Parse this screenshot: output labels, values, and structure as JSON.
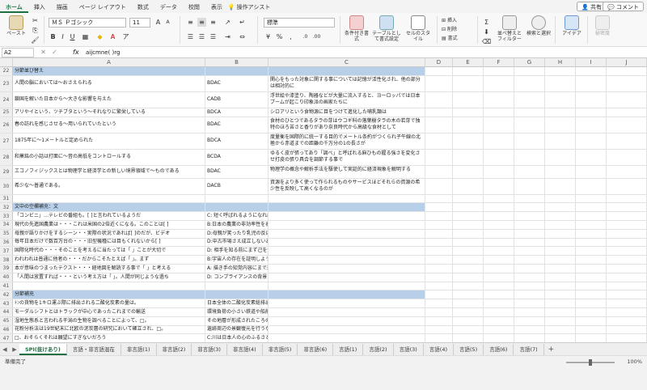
{
  "tabs": [
    "ホーム",
    "挿入",
    "描画",
    "ページ レイアウト",
    "数式",
    "データ",
    "校閲",
    "表示"
  ],
  "tab_search": "操作アシスト",
  "share_label": "共有",
  "comment_label": "コメント",
  "ribbon": {
    "paste_label": "ペースト",
    "font_name": "ＭＳ Ｐゴシック",
    "font_size": "11",
    "number_format": "標準",
    "conditional_format": "条件付き書式",
    "format_as_table": "テーブルとして書式設定",
    "cell_styles": "セルのスタイル",
    "insert": "挿入",
    "delete": "削除",
    "format": "書式",
    "sort_filter": "並べ替えとフィルター",
    "find_select": "検索と選択",
    "ideas": "アイデア",
    "sensitivity": "秘密度"
  },
  "formula_bar": {
    "cell_ref": "A2",
    "fx": "fx",
    "value": "aijcmne( )rg"
  },
  "columns": [
    "A",
    "B",
    "C",
    "D",
    "E",
    "F",
    "G",
    "H",
    "I",
    "J"
  ],
  "rows": [
    {
      "n": "22",
      "a": "分節並び替え",
      "b": "",
      "c": "",
      "section": true
    },
    {
      "n": "23",
      "a": "人間の脳においては～おさえられる",
      "b": "BDAC",
      "c": "関心をもった対象に関する事については記憶が活性化され、他の部分は相対的に"
    },
    {
      "n": "24",
      "a": "鎖国を解いた日本から～大きな影響を与えた",
      "b": "CADB",
      "c": "浮世絵や漆塗り、陶器などが大量に流入すると、ヨーロッパでは日本ブームが起こり印象派の画家たちに"
    },
    {
      "n": "25",
      "a": "アリやイという、ツチブタという～それなりに繁栄している",
      "b": "BDCA",
      "c": "シロアリという食物源に目をつけて進化した哺乳類は"
    },
    {
      "n": "26",
      "a": "春の訪れを感じさせる～用いられていたという",
      "b": "BDAC",
      "c": "食材のひとつであるタラの芽はウコギ科の落葉樹タラの木の若芽で独特のほろ苦さと香りがあり奈良時代から高級な食材として"
    },
    {
      "n": "27",
      "a": "1875年に～1メートルと定められた",
      "b": "BDCA",
      "c": "度量衡を国際的に統一する目的でメートル条約がつくられ子午線の北極から赤道までの距離の千万分の1の長さが"
    },
    {
      "n": "28",
      "a": "和菓銘の小話は打面に～音の高低をコントロールする",
      "b": "BCDA",
      "c": "ゆるく皮が張ってあり「調べ」と呼ばれる麻ひもの握る強さを変化させ打皮の張り具合を調節する事で"
    },
    {
      "n": "29",
      "a": "エコノフィジックスとは物理学と経済学との新しい境界領域で～ものである",
      "b": "BDAC",
      "c": "物理学の概念や解析手法を駆使して実証的に経済現象を解明する"
    },
    {
      "n": "30",
      "a": "希少な～普通である。",
      "b": "DACB",
      "c": "資源をより多く使って作られるものやサービスほどそれらの資源の希少性を反映して高くなるのが"
    },
    {
      "n": "31",
      "a": "",
      "b": "",
      "c": ""
    },
    {
      "n": "32",
      "a": "文中の空欄補充：文",
      "b": "",
      "c": "",
      "section": true
    },
    {
      "n": "33",
      "a": "「コンビニ」…テレビの番組も。[ ]と言われているようだ",
      "b": "C: 短く呼ばれるようになればヒット間然だ",
      "c": ""
    },
    {
      "n": "34",
      "a": "現代の先進国農業は・・・これは米国の2倍近くになる。このことは[ ]",
      "b": "B:日本の農業の非効率性を表している",
      "c": ""
    },
    {
      "n": "35",
      "a": "母親が語りかけをするシーン・・実際の状況であれば[ ]のだが、ビデオ",
      "b": "D:母親が笑ったり乳児の反応に答えたりと",
      "c": ""
    },
    {
      "n": "36",
      "a": "毎年日本だけで数百万台の・・・旧型機種には目もくれないから[ ]",
      "b": "D:中古市場さえ成立しないありさまだ",
      "c": ""
    },
    {
      "n": "37",
      "a": "国際化時代の・・・そのことを考えるに当たっては「 」ことが大切で",
      "b": "D: 相手を知る前にまず己を知る",
      "c": ""
    },
    {
      "n": "38",
      "a": "われわれは普通に他者の・・・だからこそたとえば「 」。まず",
      "b": "B:宇宙人の存在を証明しようとする人々は",
      "c": ""
    },
    {
      "n": "39",
      "a": "本が意味のつまったテクスト・・・経地図を解読する事で「 」と考える",
      "b": "A: 描き手の知覚内容にまで近づくことが",
      "c": ""
    },
    {
      "n": "40",
      "a": "「人間は放置すれば・・・という考え方は「 」。人間が同じような過ち",
      "b": "D: コンプライアンスの背景にある法文化の",
      "c": ""
    },
    {
      "n": "41",
      "a": "",
      "b": "",
      "c": ""
    },
    {
      "n": "42",
      "a": "分節補充",
      "b": "",
      "c": "",
      "section": true
    },
    {
      "n": "43",
      "a": "ﾄﾝの貨物を1キロ運ぶ際に排出される二酸化炭素の量は。",
      "b": "日本全体の二酸化炭素総排出量の約2割",
      "c": ""
    },
    {
      "n": "44",
      "a": "モーダルシフトとはトラックが中心であったこれまでの輸送",
      "b": "環境負荷の小さい鉄道や船舶による輸送",
      "c": ""
    },
    {
      "n": "45",
      "a": "湿地生態系と言われる干潟の生物を調べることによって、□。",
      "b": "その地層が形成されたころの周囲の植生や",
      "c": ""
    },
    {
      "n": "46",
      "a": "花粉分析法は19世紀末に北欧の泥炭層の研究において確立され、□。",
      "b": "遺跡周辺の景観復元を行うなど環境考古学",
      "c": ""
    },
    {
      "n": "47",
      "a": "□、おそらくそれは願望にすぎないだろう",
      "b": "C:川は日本人の心のふるさとだと答える",
      "c": ""
    },
    {
      "n": "48",
      "a": "□、同時に水利を可能ならしめるものであった",
      "b": "D:森林に囲まれていた事は土壌の豊かさを示す",
      "c": ""
    },
    {
      "n": "49",
      "a": "エレクトロニクス製品の故障が起こる季節確率は",
      "b": "D:非常に低い事を優れた人は知っている",
      "c": ""
    }
  ],
  "sheet_tabs": [
    "SPI(抜けあり)",
    "言語・非言語混在",
    "非言語(1)",
    "非言語(2)",
    "非言語(3)",
    "非言語(4)",
    "非言語(5)",
    "非言語(6)",
    "言語(1)",
    "言語(2)",
    "言語(3)",
    "言語(4)",
    "言語(5)",
    "言語(6)",
    "言語(7)"
  ],
  "status_text": "準備完了",
  "zoom": "100%"
}
